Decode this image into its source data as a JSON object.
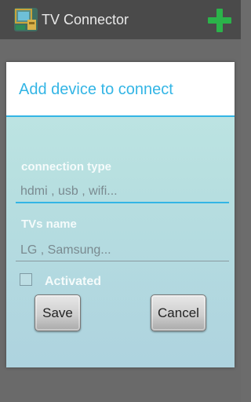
{
  "app_bar": {
    "title": "TV Connector",
    "app_icon": "tv-connector-app-icon",
    "add_icon": "plus-icon",
    "add_color": "#2bb34a"
  },
  "dialog": {
    "title": "Add device to connect",
    "accent_color": "#33b5e5",
    "connection_type": {
      "label": "connection type",
      "value": "",
      "placeholder": "hdmi , usb , wifi..."
    },
    "tv_name": {
      "label": "TVs name",
      "value": "",
      "placeholder": "LG , Samsung..."
    },
    "activated": {
      "label": "Activated",
      "checked": false
    },
    "save_label": "Save",
    "cancel_label": "Cancel"
  }
}
